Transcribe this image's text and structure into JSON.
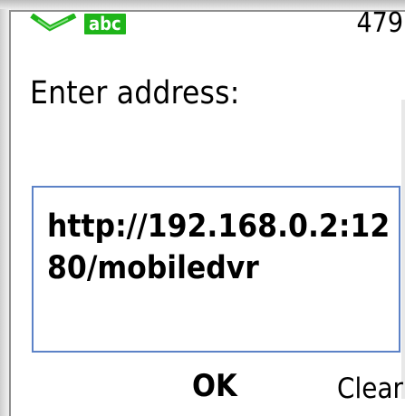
{
  "status_bar": {
    "indicator_icon": "input-indicator-icon",
    "input_mode": "abc",
    "char_counter": "479"
  },
  "prompt": {
    "label": "Enter address:"
  },
  "address_field": {
    "value": "http://192.168.0.2:1280/mobiledvr"
  },
  "softkeys": {
    "center": "OK",
    "right": "Clear"
  },
  "colors": {
    "mode_badge": "#1fb51a",
    "field_border": "#5c82c7"
  }
}
